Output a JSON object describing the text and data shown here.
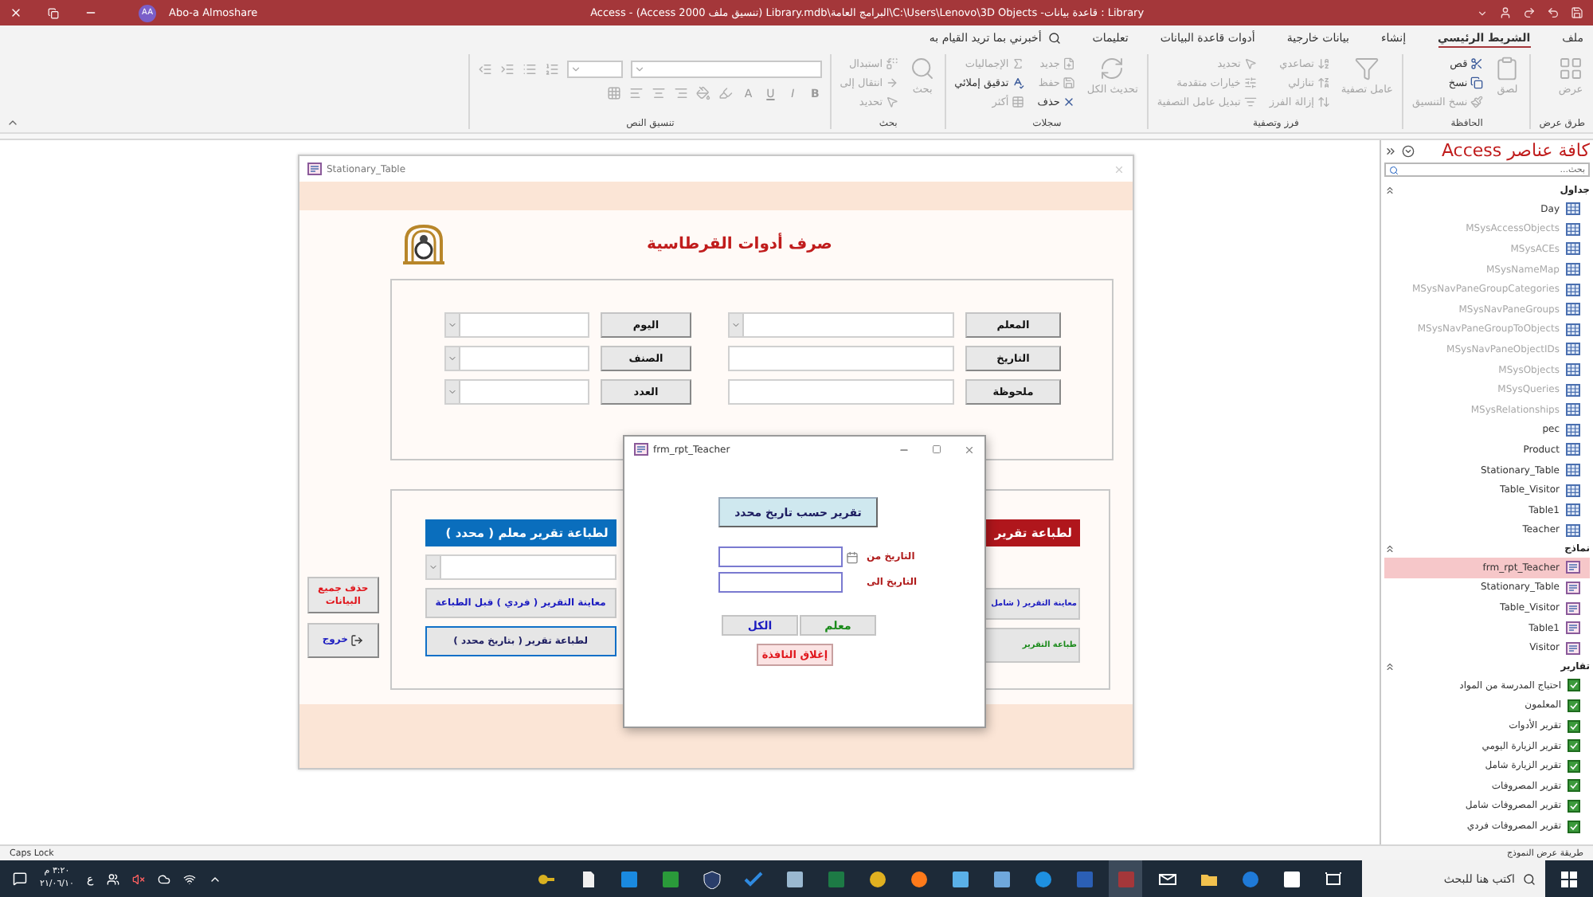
{
  "title_bar": {
    "title": "Library : قاعدة بيانات- C:\\Users\\Lenovo\\3D Objects\\البرامج العامة\\Library.mdb (تنسيق ملف Access 2000) - Access",
    "user_initials": "AA",
    "user_name": "Abo-a Almoshare"
  },
  "ribbon": {
    "tabs": [
      {
        "label": "ملف",
        "selected": false
      },
      {
        "label": "الشريط الرئيسي",
        "selected": true
      },
      {
        "label": "إنشاء",
        "selected": false
      },
      {
        "label": "بيانات خارجية",
        "selected": false
      },
      {
        "label": "أدوات قاعدة البيانات",
        "selected": false
      },
      {
        "label": "تعليمات",
        "selected": false
      }
    ],
    "tell_me": "أخبرني بما تريد القيام به",
    "groups": [
      {
        "label": "طرق عرض",
        "kind": "commands",
        "main": {
          "label": "عرض",
          "disabled": true
        }
      },
      {
        "label": "الحافظة",
        "kind": "commands",
        "main": {
          "label": "لصق",
          "disabled": true
        },
        "items": [
          {
            "label": "قص",
            "disabled": false
          },
          {
            "label": "نسخ",
            "disabled": false
          },
          {
            "label": "نسخ التنسيق",
            "disabled": true
          }
        ]
      },
      {
        "label": "فرز وتصفية",
        "kind": "commands",
        "main": {
          "label": "عامل تصفية",
          "disabled": true
        },
        "items": [
          {
            "label": "تصاعدي",
            "disabled": true
          },
          {
            "label": "تنازلي",
            "disabled": true
          },
          {
            "label": "إزالة الفرز",
            "disabled": true
          },
          {
            "label": "تحديد",
            "disabled": true
          },
          {
            "label": "خيارات متقدمة",
            "disabled": true
          },
          {
            "label": "تبديل عامل التصفية",
            "disabled": true
          }
        ]
      },
      {
        "label": "سجلات",
        "kind": "commands",
        "main": {
          "label": "تحديث الكل",
          "disabled": true
        },
        "items": [
          {
            "label": "جديد",
            "disabled": true
          },
          {
            "label": "حفظ",
            "disabled": true
          },
          {
            "label": "حذف",
            "disabled": false
          },
          {
            "label": "الإجماليات",
            "disabled": true
          },
          {
            "label": "تدقيق إملائي",
            "disabled": false
          },
          {
            "label": "أكثر",
            "disabled": true
          }
        ]
      },
      {
        "label": "بحث",
        "kind": "commands",
        "main": {
          "label": "بحث",
          "disabled": true
        },
        "items": [
          {
            "label": "استبدال",
            "disabled": true
          },
          {
            "label": "انتقال إلى",
            "disabled": true
          },
          {
            "label": "تحديد",
            "disabled": true
          }
        ]
      },
      {
        "label": "تنسيق النص",
        "kind": "format",
        "format_keys": [
          "B",
          "I",
          "U",
          "A"
        ]
      }
    ]
  },
  "form": {
    "title": "Stationary_Table",
    "heading": "صرف أدوات القرطاسية",
    "fields_right": [
      {
        "label": "المعلم",
        "kind": "combo"
      },
      {
        "label": "التاريخ",
        "kind": "text"
      },
      {
        "label": "ملحوظة",
        "kind": "text"
      }
    ],
    "fields_left": [
      {
        "label": "اليوم",
        "kind": "combo"
      },
      {
        "label": "الصنف",
        "kind": "combo"
      },
      {
        "label": "العدد",
        "kind": "combo"
      }
    ],
    "teacher_panel": {
      "header": "لطباعة تقرير معلم ( محدد )",
      "color": "#0a6ebd",
      "buttons": [
        {
          "label": "معاينة التقرير ( فردي ) قبل الطباعة",
          "color": "#1c1cc0",
          "focused": false
        },
        {
          "label": "لطباعة تقرير ( بتاريخ محدد )",
          "color": "#1c1c60",
          "focused": true
        }
      ]
    },
    "general_panel": {
      "header": "لطباعة تقرير",
      "color": "#b0161c",
      "buttons": [
        {
          "label": "معاينة التقرير ( شامل",
          "color": "#1c1cc0",
          "focused": false
        },
        {
          "label": "طباعة التقرير",
          "color": "#1a8a1a",
          "focused": false
        }
      ]
    },
    "side_buttons": [
      {
        "label": "حذف جميع البيانات",
        "color": "#e0161c"
      },
      {
        "label": "خروج",
        "color": "#1c1cc0"
      }
    ]
  },
  "dialog": {
    "title": "frm_rpt_Teacher",
    "report_button": "تقرير حسب تاريخ محدد",
    "date_fields": [
      {
        "label": "التاريخ من",
        "calendar": true
      },
      {
        "label": "التاريخ الى",
        "calendar": false
      }
    ],
    "buttons": [
      {
        "label": "معلم",
        "color": "#1a8a1a"
      },
      {
        "label": "الكل",
        "color": "#1c1cc0"
      }
    ],
    "close_button": "إغلاق النافذة"
  },
  "nav_pane": {
    "title": "كافة عناصر Access",
    "search_placeholder": "بحث...",
    "groups": [
      {
        "label": "جداول",
        "kind": "table",
        "expanded": true,
        "items": [
          {
            "label": "Day",
            "system": false,
            "selected": false
          },
          {
            "label": "MSysAccessObjects",
            "system": true,
            "selected": false
          },
          {
            "label": "MSysACEs",
            "system": true,
            "selected": false
          },
          {
            "label": "MSysNameMap",
            "system": true,
            "selected": false
          },
          {
            "label": "MSysNavPaneGroupCategories",
            "system": true,
            "selected": false
          },
          {
            "label": "MSysNavPaneGroups",
            "system": true,
            "selected": false
          },
          {
            "label": "MSysNavPaneGroupToObjects",
            "system": true,
            "selected": false
          },
          {
            "label": "MSysNavPaneObjectIDs",
            "system": true,
            "selected": false
          },
          {
            "label": "MSysObjects",
            "system": true,
            "selected": false
          },
          {
            "label": "MSysQueries",
            "system": true,
            "selected": false
          },
          {
            "label": "MSysRelationships",
            "system": true,
            "selected": false
          },
          {
            "label": "pec",
            "system": false,
            "selected": false
          },
          {
            "label": "Product",
            "system": false,
            "selected": false
          },
          {
            "label": "Stationary_Table",
            "system": false,
            "selected": false
          },
          {
            "label": "Table_Visitor",
            "system": false,
            "selected": false
          },
          {
            "label": "Table1",
            "system": false,
            "selected": false
          },
          {
            "label": "Teacher",
            "system": false,
            "selected": false
          }
        ]
      },
      {
        "label": "نماذج",
        "kind": "form",
        "expanded": true,
        "items": [
          {
            "label": "frm_rpt_Teacher",
            "system": false,
            "selected": true
          },
          {
            "label": "Stationary_Table",
            "system": false,
            "selected": false
          },
          {
            "label": "Table_Visitor",
            "system": false,
            "selected": false
          },
          {
            "label": "Table1",
            "system": false,
            "selected": false
          },
          {
            "label": "Visitor",
            "system": false,
            "selected": false
          }
        ]
      },
      {
        "label": "تقارير",
        "kind": "report",
        "expanded": true,
        "items": [
          {
            "label": "احتياج المدرسة من المواد",
            "system": false,
            "selected": false
          },
          {
            "label": "المعلمون",
            "system": false,
            "selected": false
          },
          {
            "label": "تقرير الأدوات",
            "system": false,
            "selected": false
          },
          {
            "label": "تقرير الزيارة اليومي",
            "system": false,
            "selected": false
          },
          {
            "label": "تقرير الزيارة شامل",
            "system": false,
            "selected": false
          },
          {
            "label": "تقرير المصروفات",
            "system": false,
            "selected": false
          },
          {
            "label": "تقرير المصروفات شامل",
            "system": false,
            "selected": false
          },
          {
            "label": "تقرير المصروفات فردي",
            "system": false,
            "selected": false
          }
        ]
      }
    ]
  },
  "status_bar": {
    "left": "Caps Lock",
    "right": "طريقة عرض النموذج"
  },
  "taskbar": {
    "search_placeholder": "اكتب هنا للبحث",
    "language": "ع",
    "time": "٣:٢٠ م",
    "date": "٢١/٠٦/١٠"
  }
}
